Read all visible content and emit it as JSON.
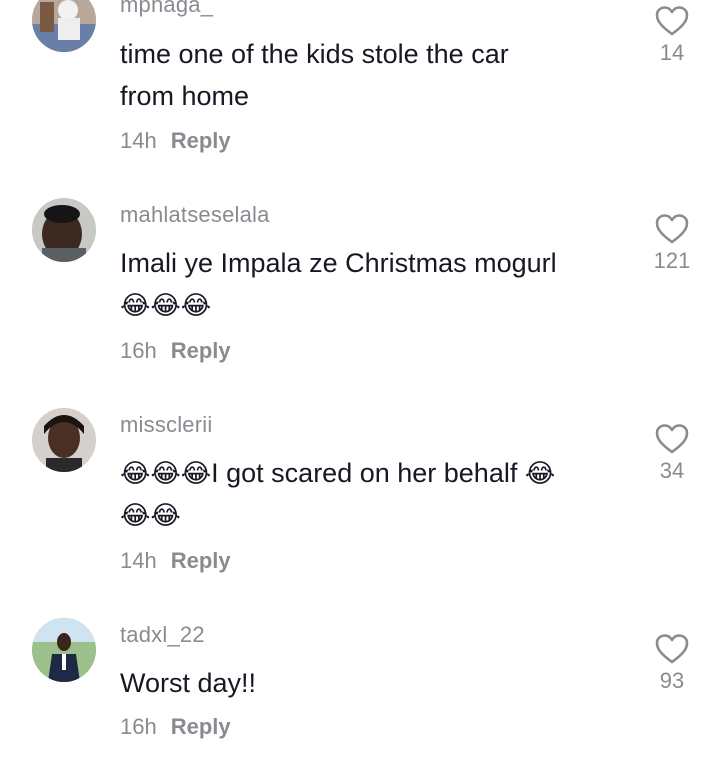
{
  "comments": [
    {
      "username": "mphaga_",
      "text": "time one of the kids stole the car from home",
      "time": "14h",
      "reply": "Reply",
      "likes": "14"
    },
    {
      "username": "mahlatseselala",
      "text": "Imali ye Impala ze Christmas mogurl",
      "emoji": "😂😂😂",
      "time": "16h",
      "reply": "Reply",
      "likes": "121"
    },
    {
      "username": "missclerii",
      "text_emoji": "😂😂😂",
      "text": "I got scared on her behalf",
      "text_emoji_after": "😂",
      "emoji": "😂😂",
      "time": "14h",
      "reply": "Reply",
      "likes": "34"
    },
    {
      "username": "tadxl_22",
      "text": "Worst day!!",
      "time": "16h",
      "reply": "Reply",
      "likes": "93"
    }
  ],
  "icons": {
    "like": "heart-outline-icon"
  },
  "colors": {
    "text": "#161823",
    "secondary": "#8a8b91",
    "background": "#ffffff"
  }
}
